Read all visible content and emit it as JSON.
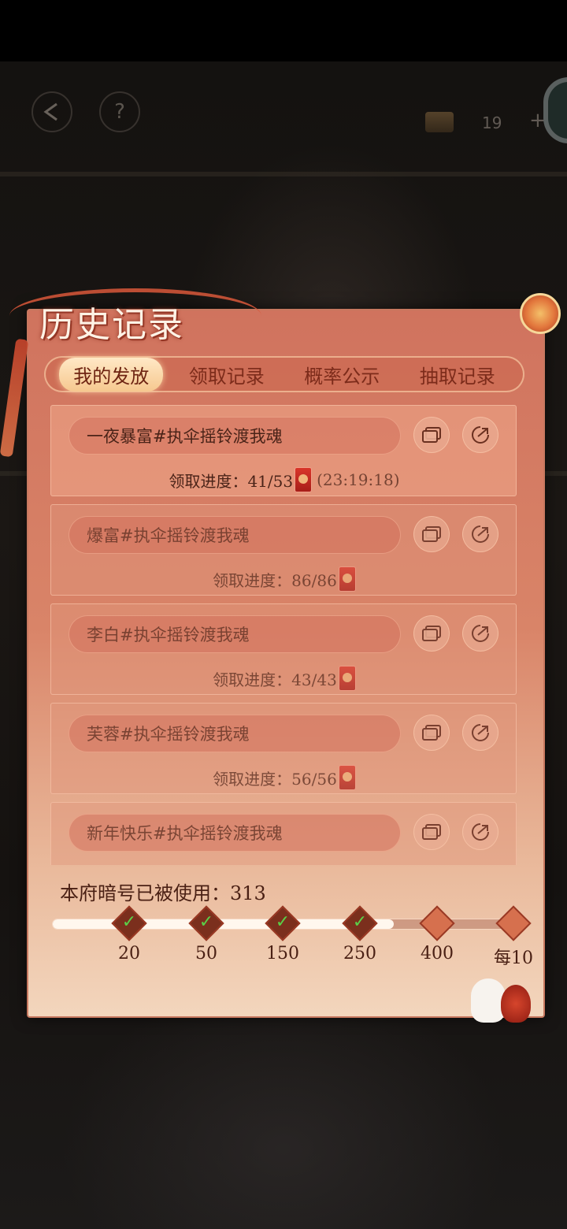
{
  "topbar": {
    "back_icon": "back-arrow-icon",
    "help_label": "?",
    "coin_count": "19",
    "plus_label": "+"
  },
  "panel": {
    "title": "历史记录",
    "tabs": [
      {
        "label": "我的发放",
        "active": true
      },
      {
        "label": "领取记录",
        "active": false
      },
      {
        "label": "概率公示",
        "active": false
      },
      {
        "label": "抽取记录",
        "active": false
      }
    ],
    "records": [
      {
        "name": "一夜暴富#执伞摇铃渡我魂",
        "progress_label": "领取进度：41/53",
        "timer": "(23:19:18)",
        "active": true
      },
      {
        "name": "爆富#执伞摇铃渡我魂",
        "progress_label": "领取进度：86/86",
        "timer": "",
        "active": false
      },
      {
        "name": "李白#执伞摇铃渡我魂",
        "progress_label": "领取进度：43/43",
        "timer": "",
        "active": false
      },
      {
        "name": "芙蓉#执伞摇铃渡我魂",
        "progress_label": "领取进度：56/56",
        "timer": "",
        "active": false
      },
      {
        "name": "新年快乐#执伞摇铃渡我魂",
        "progress_label": "",
        "timer": "",
        "active": false
      }
    ],
    "usage_text": "本府暗号已被使用：313",
    "milestones": [
      {
        "label": "20",
        "done": true
      },
      {
        "label": "50",
        "done": true
      },
      {
        "label": "150",
        "done": true
      },
      {
        "label": "250",
        "done": true
      },
      {
        "label": "400",
        "done": false
      },
      {
        "label": "每10",
        "done": false
      }
    ],
    "progress_fraction": 0.72
  },
  "colors": {
    "accent": "#d9583a",
    "panel_top": "#d0735e",
    "panel_bottom": "#f3d6bd",
    "text_dark": "#4a2318",
    "check_green": "#5ad048"
  }
}
